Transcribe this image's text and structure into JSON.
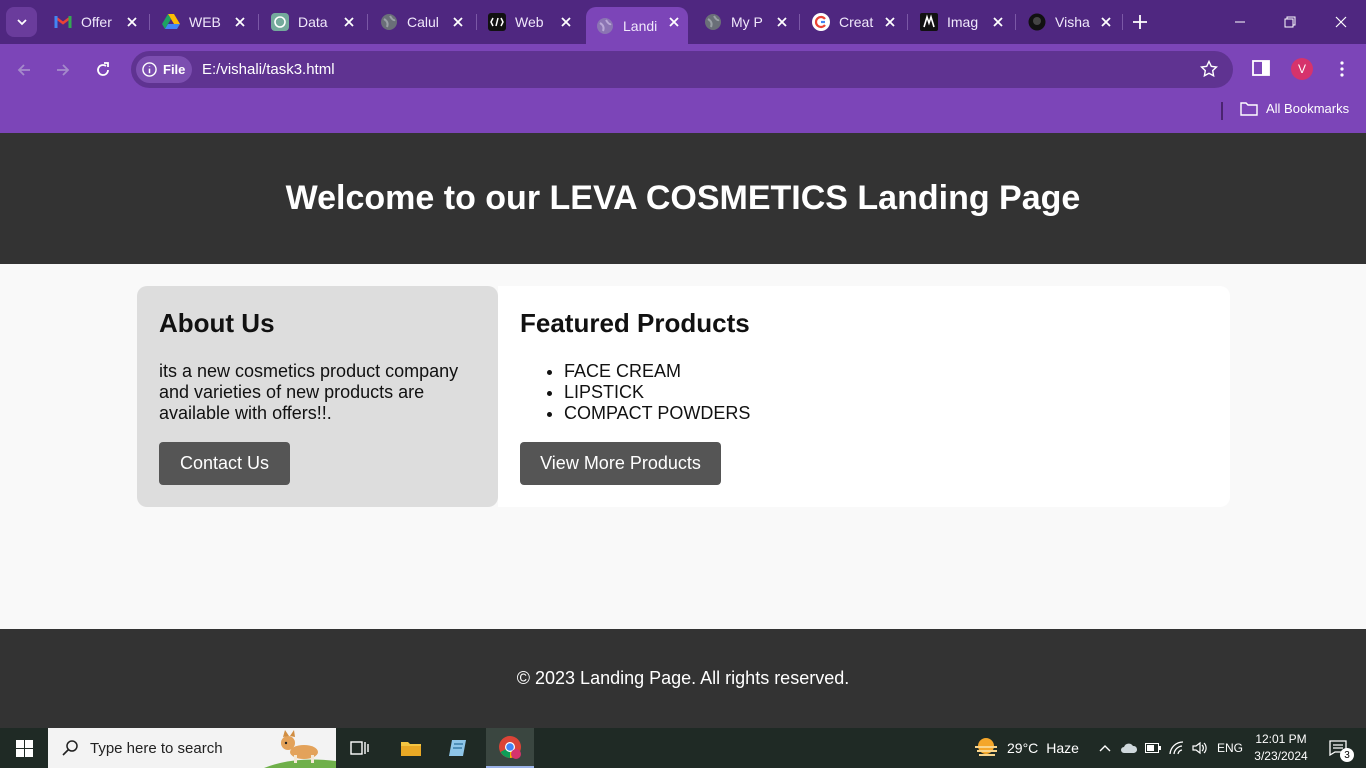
{
  "browser": {
    "tabs": [
      {
        "title": "Offer",
        "icon": "gmail-icon"
      },
      {
        "title": "WEB",
        "icon": "google-drive-icon"
      },
      {
        "title": "Data",
        "icon": "chatgpt-icon"
      },
      {
        "title": "Calul",
        "icon": "globe-icon"
      },
      {
        "title": "Web",
        "icon": "codepen-icon"
      },
      {
        "title": "Landi",
        "icon": "globe-icon",
        "active": true
      },
      {
        "title": "My P",
        "icon": "globe-icon"
      },
      {
        "title": "Creat",
        "icon": "google-icon"
      },
      {
        "title": "Imag",
        "icon": "m-logo-icon"
      },
      {
        "title": "Visha",
        "icon": "github-icon"
      }
    ],
    "address": {
      "chip_label": "File",
      "url": "E:/vishali/task3.html"
    },
    "profile_initial": "V",
    "bookmarks_label": "All Bookmarks",
    "colors": {
      "tabbar": "#4f2780",
      "toolbar": "#7c45b8",
      "omnibox": "#5f3391"
    }
  },
  "page": {
    "header_title": "Welcome to our LEVA COSMETICS Landing Page",
    "about": {
      "heading": "About Us",
      "text": "its a new cosmetics product company and varieties of new products are available with offers!!.",
      "button": "Contact Us"
    },
    "products": {
      "heading": "Featured Products",
      "items": [
        "FACE CREAM",
        "LIPSTICK",
        "COMPACT POWDERS"
      ],
      "button": "View More Products"
    },
    "footer": "© 2023 Landing Page. All rights reserved.",
    "colors": {
      "header_bg": "#333333",
      "about_bg": "#dddddd",
      "button_bg": "#555555"
    }
  },
  "taskbar": {
    "search_placeholder": "Type here to search",
    "weather": {
      "temp": "29°C",
      "condition": "Haze"
    },
    "language": "ENG",
    "time": "12:01 PM",
    "date": "3/23/2024",
    "notification_count": "3"
  }
}
